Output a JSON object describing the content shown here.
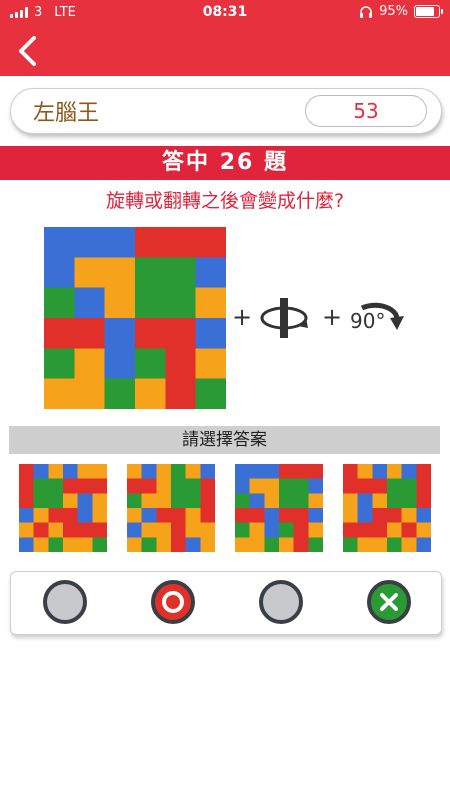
{
  "status": {
    "carrier": "3",
    "network": "LTE",
    "time": "08:31",
    "battery": "95%"
  },
  "header": {
    "back_icon": "chevron-left-icon"
  },
  "scorecard": {
    "title": "左腦王",
    "score": "53"
  },
  "banner": {
    "answered_text": "答中 26 題"
  },
  "question": {
    "text": "旋轉或翻轉之後會變成什麼?"
  },
  "operations": {
    "plus1": "+",
    "plus2": "+",
    "angle": "90°",
    "flip_icon": "flip-vertical-axis-icon",
    "rotate_icon": "rotate-clockwise-icon"
  },
  "choose": {
    "label": "請選擇答案"
  },
  "answers": {
    "marks": [
      "unselected",
      "selected",
      "unselected",
      "wrong"
    ]
  },
  "colors": {
    "red": "#e1302a",
    "blue": "#3a6fd6",
    "orange": "#f6a21a",
    "green": "#2a9a34",
    "gray": "#c7c9cc",
    "header": "#e8313f"
  }
}
